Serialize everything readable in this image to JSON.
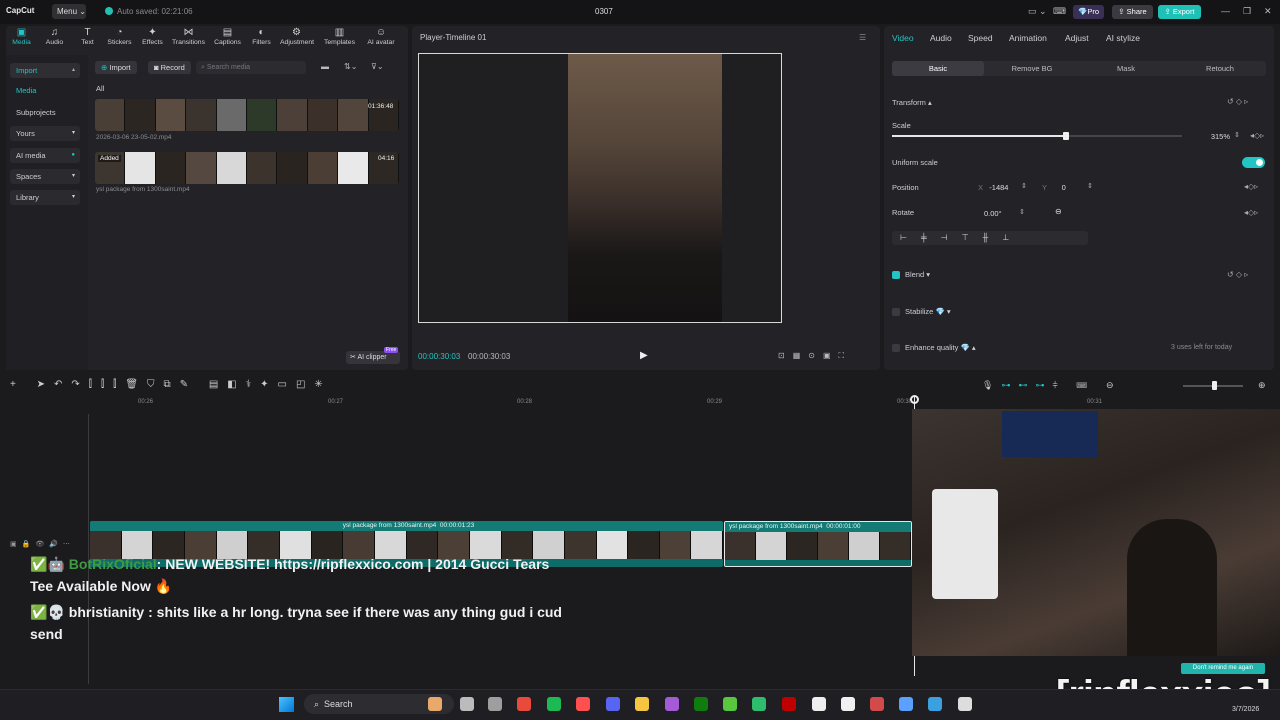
{
  "app": {
    "logo": "CapCut",
    "menu_label": "Menu",
    "autosave": "Auto saved: 02:21:06",
    "doc_title": "0307",
    "pro_label": "Pro",
    "share_label": "Share",
    "export_label": "Export"
  },
  "toolbar": {
    "tabs": [
      {
        "label": "Media",
        "icon": "media-icon"
      },
      {
        "label": "Audio",
        "icon": "audio-icon"
      },
      {
        "label": "Text",
        "icon": "text-icon"
      },
      {
        "label": "Stickers",
        "icon": "stickers-icon"
      },
      {
        "label": "Effects",
        "icon": "effects-icon"
      },
      {
        "label": "Transitions",
        "icon": "transitions-icon"
      },
      {
        "label": "Captions",
        "icon": "captions-icon"
      },
      {
        "label": "Filters",
        "icon": "filters-icon"
      },
      {
        "label": "Adjustment",
        "icon": "adjustment-icon"
      },
      {
        "label": "Templates",
        "icon": "templates-icon"
      },
      {
        "label": "AI avatar",
        "icon": "ai-avatar-icon"
      }
    ]
  },
  "sidenav": {
    "items": [
      "Import",
      "Media",
      "Subprojects",
      "Yours",
      "AI media",
      "Spaces",
      "Library"
    ]
  },
  "media": {
    "import_label": "Import",
    "record_label": "Record",
    "search_placeholder": "Search media",
    "filter_all": "All",
    "clips": [
      {
        "name": "2026-03-06 23-05-02.mp4",
        "duration": "01:36:48",
        "badge": ""
      },
      {
        "name": "ysl package from 1300saint.mp4",
        "duration": "04:16",
        "badge": "Added"
      }
    ],
    "ai_clipper": "AI clipper",
    "free_badge": "Free"
  },
  "player": {
    "title": "Player-Timeline 01",
    "current_time": "00:00:30:03",
    "total_time": "00:00:30:03"
  },
  "inspector": {
    "tabs": [
      "Video",
      "Audio",
      "Speed",
      "Animation",
      "Adjust",
      "AI stylize"
    ],
    "subtabs": [
      "Basic",
      "Remove BG",
      "Mask",
      "Retouch"
    ],
    "transform_label": "Transform",
    "scale_label": "Scale",
    "scale_value": "315%",
    "scale_level": 0.6,
    "uniform_label": "Uniform scale",
    "position_label": "Position",
    "pos_x_label": "X",
    "pos_x": "-1484",
    "pos_y_label": "Y",
    "pos_y": "0",
    "rotate_label": "Rotate",
    "rotate_value": "0.00°",
    "blend_label": "Blend",
    "stabilize_label": "Stabilize",
    "enhance_label": "Enhance quality",
    "uses_left": "3 uses left for today"
  },
  "timeline": {
    "ticks": [
      "00:26",
      "00:27",
      "00:28",
      "00:29",
      "00:30",
      "00:31"
    ],
    "clips": [
      {
        "label": "ysl package from 1300saint.mp4",
        "duration": "00:00:01:23"
      },
      {
        "label": "ysl package from 1300saint.mp4",
        "duration": "00:00:01:00"
      }
    ]
  },
  "chat": {
    "lines": [
      {
        "user": "BotRixOficial",
        "message": ": NEW WEBSITE! https://ripflexxico.com | 2014 Gucci Tears Tee Available Now 🔥"
      },
      {
        "user": "bhristianity",
        "message": " : shits like a hr long. tryna see if there was any thing gud i cud send"
      }
    ]
  },
  "overlay": {
    "dont_remind": "Don't remind me again",
    "watermark": "[ripflexxico]"
  },
  "taskbar": {
    "search_label": "Search",
    "date": "3/7/2026"
  }
}
